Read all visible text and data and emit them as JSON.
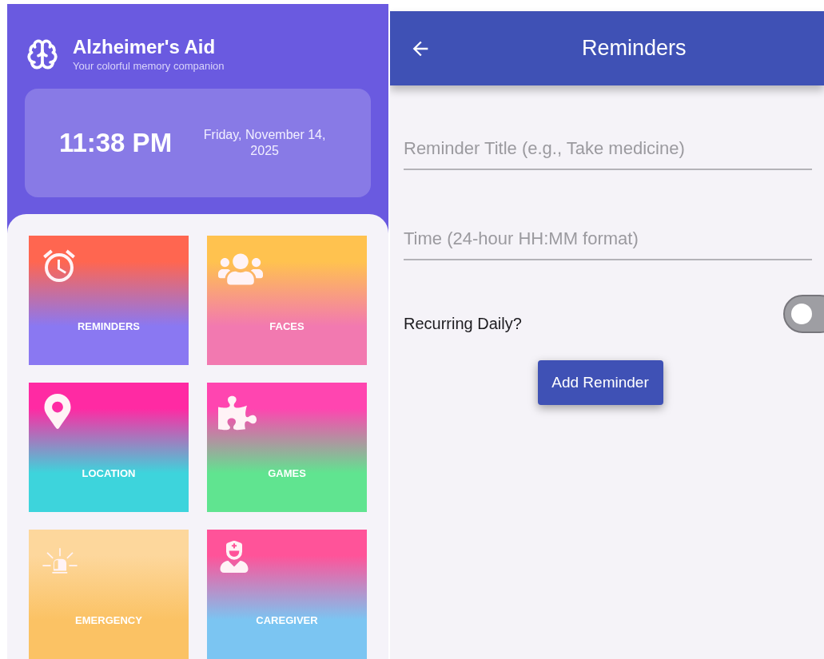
{
  "home": {
    "app_title": "Alzheimer's Aid",
    "subtitle": "Your colorful memory companion",
    "clock": {
      "time": "11:38 PM",
      "date": "Friday, November 14, 2025"
    },
    "tiles": [
      {
        "label": "REMINDERS",
        "color": "#ff6650"
      },
      {
        "label": "FACES",
        "color": "#ffc24f"
      },
      {
        "label": "LOCATION",
        "color": "#ff2aa3"
      },
      {
        "label": "GAMES",
        "color": "#ff45b0"
      },
      {
        "label": "EMERGENCY",
        "color": "#fdd79c"
      },
      {
        "label": "CAREGIVER",
        "color": "#ff5399"
      }
    ]
  },
  "reminders": {
    "title": "Reminders",
    "fields": [
      {
        "placeholder": "Reminder Title (e.g., Take medicine)"
      },
      {
        "placeholder": "Time (24-hour HH:MM format)"
      }
    ],
    "recurring": {
      "label": "Recurring Daily?",
      "on": false
    },
    "button": "Add Reminder"
  }
}
